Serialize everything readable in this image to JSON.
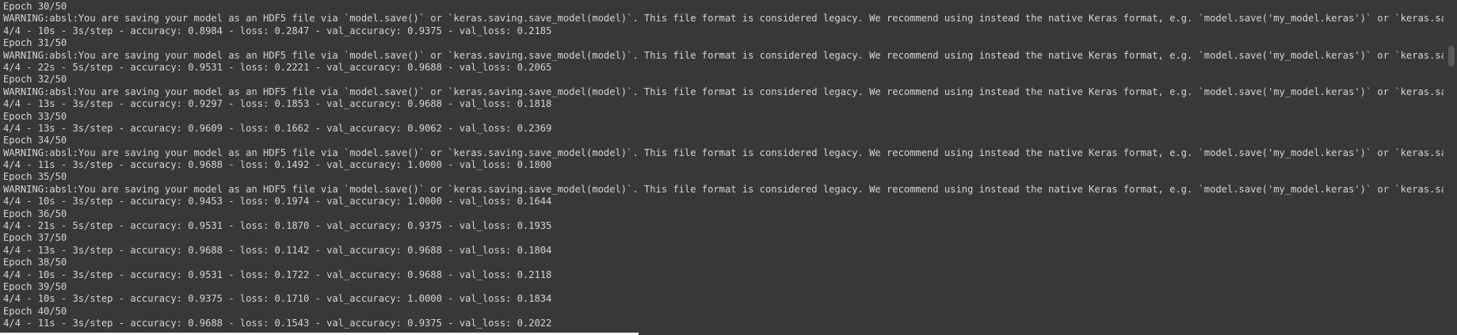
{
  "log": {
    "lines": [
      "Epoch 30/50",
      "WARNING:absl:You are saving your model as an HDF5 file via `model.save()` or `keras.saving.save_model(model)`. This file format is considered legacy. We recommend using instead the native Keras format, e.g. `model.save('my_model.keras')` or `keras.saving.save_model(model, 'my_model.keras')`.",
      "4/4 - 10s - 3s/step - accuracy: 0.8984 - loss: 0.2847 - val_accuracy: 0.9375 - val_loss: 0.2185",
      "Epoch 31/50",
      "WARNING:absl:You are saving your model as an HDF5 file via `model.save()` or `keras.saving.save_model(model)`. This file format is considered legacy. We recommend using instead the native Keras format, e.g. `model.save('my_model.keras')` or `keras.saving.save_model(model, 'my_model.keras')`.",
      "4/4 - 22s - 5s/step - accuracy: 0.9531 - loss: 0.2221 - val_accuracy: 0.9688 - val_loss: 0.2065",
      "Epoch 32/50",
      "WARNING:absl:You are saving your model as an HDF5 file via `model.save()` or `keras.saving.save_model(model)`. This file format is considered legacy. We recommend using instead the native Keras format, e.g. `model.save('my_model.keras')` or `keras.saving.save_model(model, 'my_model.keras')`.",
      "4/4 - 13s - 3s/step - accuracy: 0.9297 - loss: 0.1853 - val_accuracy: 0.9688 - val_loss: 0.1818",
      "Epoch 33/50",
      "4/4 - 13s - 3s/step - accuracy: 0.9609 - loss: 0.1662 - val_accuracy: 0.9062 - val_loss: 0.2369",
      "Epoch 34/50",
      "WARNING:absl:You are saving your model as an HDF5 file via `model.save()` or `keras.saving.save_model(model)`. This file format is considered legacy. We recommend using instead the native Keras format, e.g. `model.save('my_model.keras')` or `keras.saving.save_model(model, 'my_model.keras')`.",
      "4/4 - 11s - 3s/step - accuracy: 0.9688 - loss: 0.1492 - val_accuracy: 1.0000 - val_loss: 0.1800",
      "Epoch 35/50",
      "WARNING:absl:You are saving your model as an HDF5 file via `model.save()` or `keras.saving.save_model(model)`. This file format is considered legacy. We recommend using instead the native Keras format, e.g. `model.save('my_model.keras')` or `keras.saving.save_model(model, 'my_model.keras')`.",
      "4/4 - 10s - 3s/step - accuracy: 0.9453 - loss: 0.1974 - val_accuracy: 1.0000 - val_loss: 0.1644",
      "Epoch 36/50",
      "4/4 - 21s - 5s/step - accuracy: 0.9531 - loss: 0.1870 - val_accuracy: 0.9375 - val_loss: 0.1935",
      "Epoch 37/50",
      "4/4 - 13s - 3s/step - accuracy: 0.9688 - loss: 0.1142 - val_accuracy: 0.9688 - val_loss: 0.1804",
      "Epoch 38/50",
      "4/4 - 10s - 3s/step - accuracy: 0.9531 - loss: 0.1722 - val_accuracy: 0.9688 - val_loss: 0.2118",
      "Epoch 39/50",
      "4/4 - 10s - 3s/step - accuracy: 0.9375 - loss: 0.1710 - val_accuracy: 1.0000 - val_loss: 0.1834",
      "Epoch 40/50",
      "4/4 - 11s - 3s/step - accuracy: 0.9688 - loss: 0.1543 - val_accuracy: 0.9375 - val_loss: 0.2022"
    ]
  },
  "colors": {
    "background": "#383838",
    "text": "#d4d4d4",
    "scrollbar_thumb": "#5a5a5a"
  }
}
